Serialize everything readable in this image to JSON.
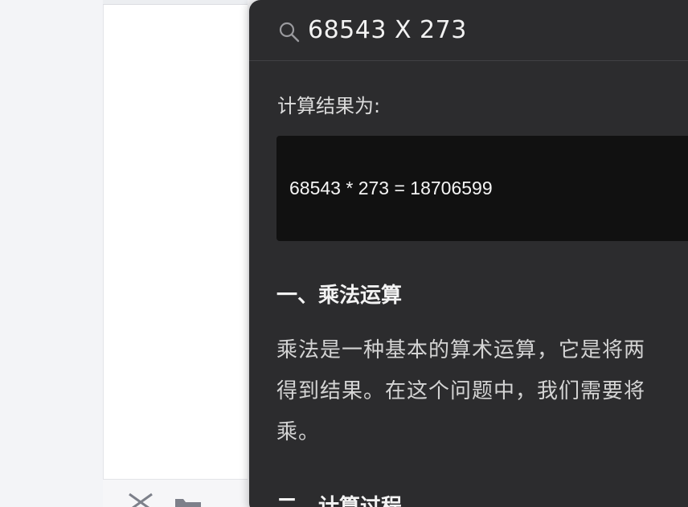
{
  "search": {
    "icon": "search-icon",
    "query": "68543 X 273"
  },
  "result": {
    "heading": "计算结果为:",
    "code": "68543 * 273 = 18706599"
  },
  "sections": [
    {
      "heading": "一、乘法运算",
      "lines": [
        "乘法是一种基本的算术运算，它是将两",
        "得到结果。在这个问题中，我们需要将",
        "乘。"
      ]
    },
    {
      "heading": "二、计算过程"
    }
  ],
  "background": {
    "bottom_icons": [
      "close-icon",
      "folder-icon"
    ]
  },
  "colors": {
    "panel": "#2c2c2e",
    "code_background": "#111111",
    "text_primary": "#f2f2f2",
    "text_secondary": "#d4d4d4"
  }
}
